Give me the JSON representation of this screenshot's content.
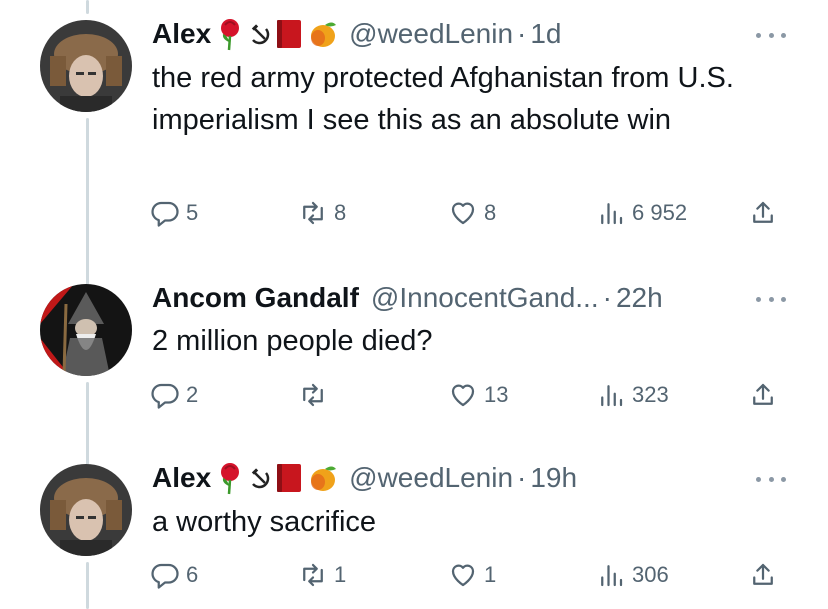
{
  "tweets": [
    {
      "name": "Alex",
      "handle": "@weedLenin",
      "time": "1d",
      "text": "the red army protected Afghanistan from U.S. imperialism I see this as an absolute win",
      "replies": "5",
      "retweets": "8",
      "likes": "8",
      "views": "6 952",
      "emojis": [
        "rose-icon",
        "hammer-sickle-icon",
        "red-book-icon",
        "mango-icon"
      ]
    },
    {
      "name": "Ancom Gandalf",
      "handle": "@InnocentGand...",
      "time": "22h",
      "text": "2 million people died?",
      "replies": "2",
      "retweets": "",
      "likes": "13",
      "views": "323",
      "emojis": []
    },
    {
      "name": "Alex",
      "handle": "@weedLenin",
      "time": "19h",
      "text": "a worthy sacrifice",
      "replies": "6",
      "retweets": "1",
      "likes": "1",
      "views": "306",
      "emojis": [
        "rose-icon",
        "hammer-sickle-icon",
        "red-book-icon",
        "mango-icon"
      ]
    }
  ],
  "separator": "·",
  "colors": {
    "text": "#0f1419",
    "muted": "#536471",
    "thread_line": "#cfd9de"
  }
}
